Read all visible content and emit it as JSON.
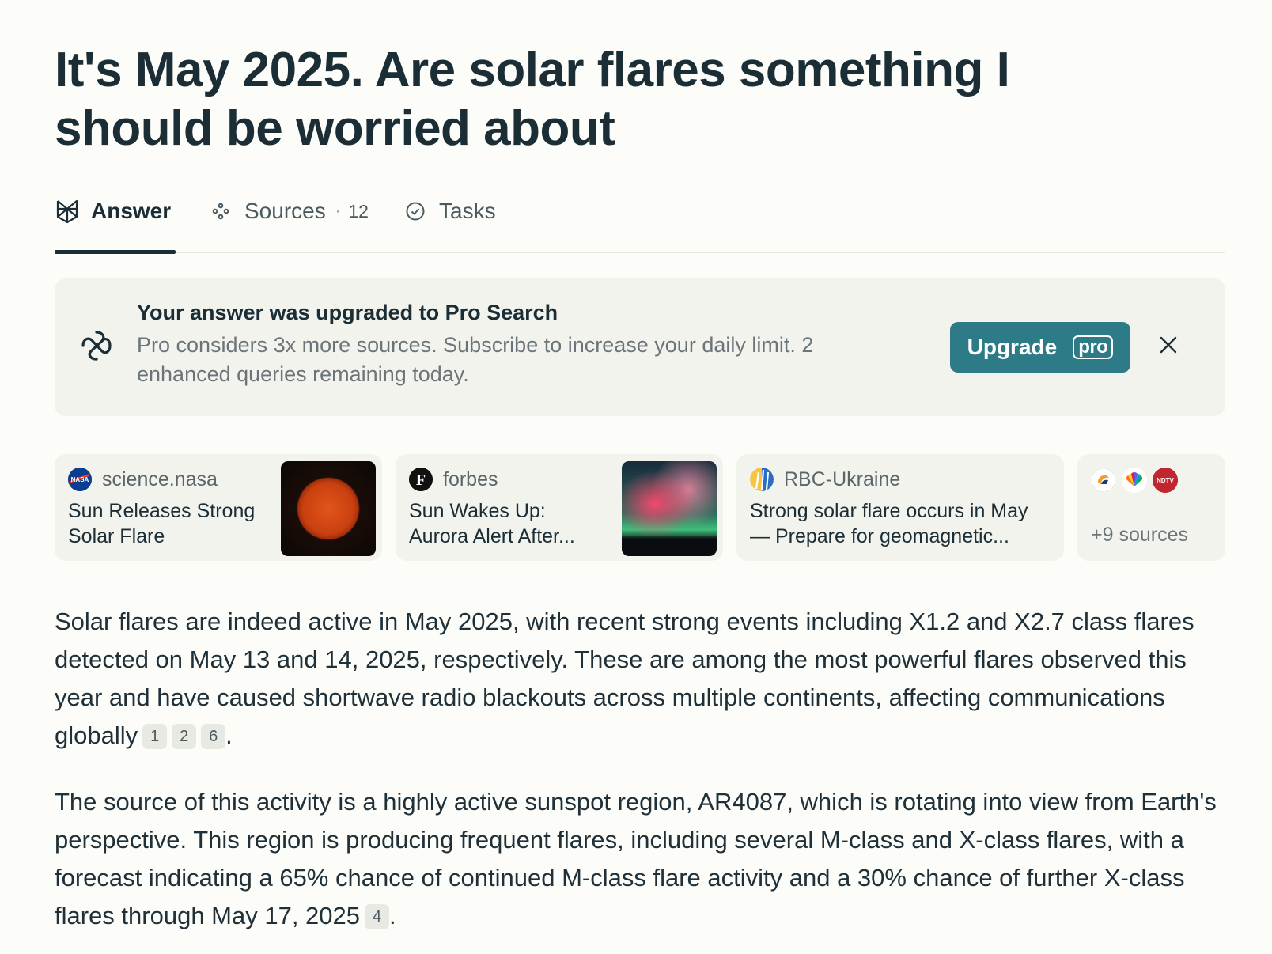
{
  "title": "It's May 2025. Are solar flares something I should be worried about",
  "tabs": {
    "answer": "Answer",
    "sources": "Sources",
    "sources_dot": "·",
    "sources_count": "12",
    "tasks": "Tasks"
  },
  "banner": {
    "title": "Your answer was upgraded to Pro Search",
    "text": "Pro considers 3x more sources. Subscribe to increase your daily limit. 2 enhanced queries remaining today.",
    "button_label": "Upgrade",
    "button_badge": "pro"
  },
  "source_cards": [
    {
      "domain": "science.nasa",
      "title": "Sun Releases Strong Solar Flare",
      "favicon": "nasa-icon"
    },
    {
      "domain": "forbes",
      "title": "Sun Wakes Up: Aurora Alert After...",
      "favicon": "forbes-icon"
    },
    {
      "domain": "RBC-Ukraine",
      "title": "Strong solar flare occurs in May — Prepare for geomagnetic...",
      "favicon": "rbc-ukraine-icon"
    }
  ],
  "more_sources": {
    "label": "+9 sources",
    "favicons": [
      "source-icon",
      "nbc-peacock-icon",
      "ndtv-icon"
    ]
  },
  "answer": {
    "para1": "Solar flares are indeed active in May 2025, with recent strong events including X1.2 and X2.7 class flares detected on May 13 and 14, 2025, respectively. These are among the most powerful flares observed this year and have caused shortwave radio blackouts across multiple continents, affecting communications globally",
    "para1_citations": [
      "1",
      "2",
      "6"
    ],
    "para2": "The source of this activity is a highly active sunspot region, AR4087, which is rotating into view from Earth's perspective. This region is producing frequent flares, including several M-class and X-class flares, with a forecast indicating a 65% chance of continued M-class flare activity and a 30% chance of further X-class flares through May 17, 2025",
    "para2_citations": [
      "4"
    ],
    "period": "."
  },
  "colors": {
    "accent": "#2e7b88",
    "text": "#1b2d35",
    "banner_bg": "#f3f3ee",
    "page_bg": "#fcfcf9"
  }
}
